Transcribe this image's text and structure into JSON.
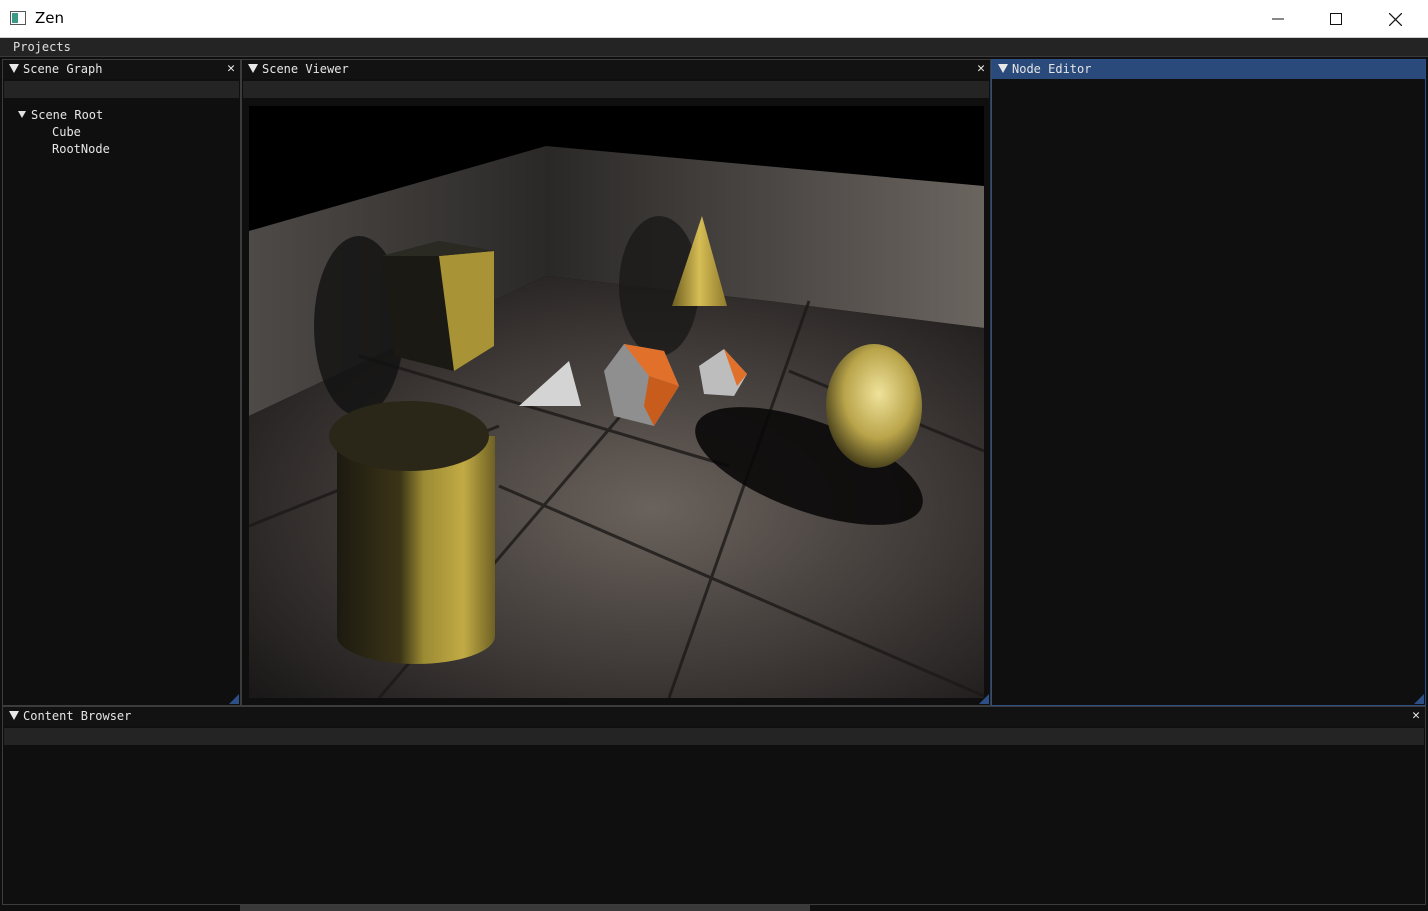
{
  "window": {
    "title": "Zen",
    "controls": {
      "minimize": "—",
      "maximize": "☐",
      "close": "✕"
    }
  },
  "menubar": {
    "items": [
      "Projects"
    ]
  },
  "panels": {
    "scene_graph": {
      "title": "Scene Graph",
      "close": "✕",
      "tree": {
        "root": "Scene Root",
        "children": [
          "Cube",
          "RootNode"
        ]
      }
    },
    "scene_viewer": {
      "title": "Scene Viewer",
      "close": "✕"
    },
    "node_editor": {
      "title": "Node Editor"
    },
    "content_browser": {
      "title": "Content Browser",
      "close": "✕"
    }
  },
  "colors": {
    "accent": "#294a7a",
    "panel_bg": "#0f0f0f",
    "strip_bg": "#242424",
    "border": "#3c3c3c"
  },
  "icons": [
    "app-icon",
    "collapse-triangle-icon",
    "close-icon",
    "tree-expand-icon"
  ]
}
